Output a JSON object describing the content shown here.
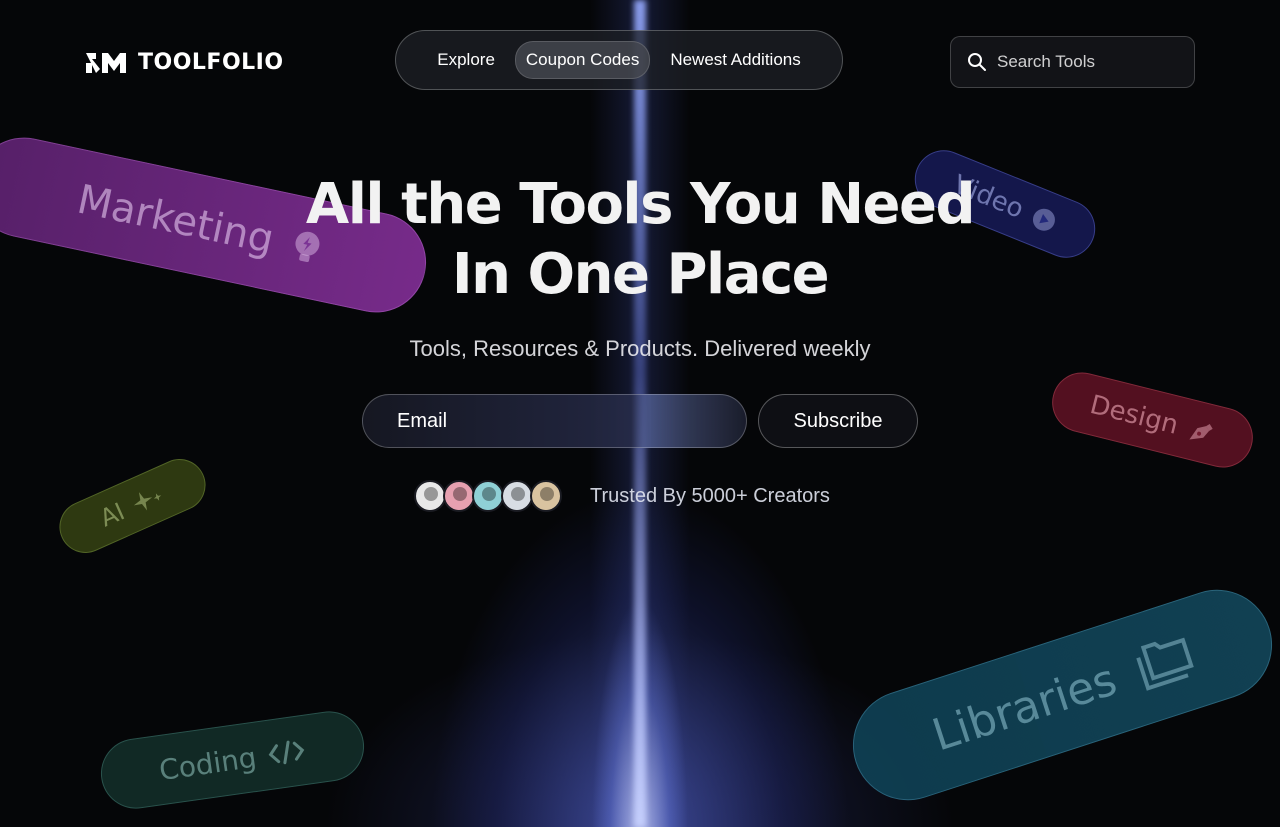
{
  "brand": {
    "name": "TOOLFOLIO"
  },
  "nav": {
    "items": [
      {
        "label": "Explore",
        "active": false
      },
      {
        "label": "Coupon Codes",
        "active": true
      },
      {
        "label": "Newest Additions",
        "active": false
      }
    ]
  },
  "search": {
    "placeholder": "Search Tools",
    "value": ""
  },
  "hero": {
    "title_line1": "All the Tools You Need",
    "title_line2": "In One Place",
    "subtitle": "Tools, Resources & Products. Delivered weekly"
  },
  "newsletter": {
    "email_placeholder": "Email",
    "email_value": "",
    "subscribe_label": "Subscribe"
  },
  "trust": {
    "text": "Trusted By 5000+ Creators",
    "avatar_colors": [
      "#e8e8e8",
      "#e6a0b0",
      "#8fd0d6",
      "#d8dde4",
      "#d9c3a0"
    ]
  },
  "categories": {
    "marketing": {
      "label": "Marketing",
      "icon": "lightbulb-icon",
      "color": "#7d2d91"
    },
    "video": {
      "label": "Video",
      "icon": "play-icon",
      "color": "#1e2378"
    },
    "design": {
      "label": "Design",
      "icon": "pen-icon",
      "color": "#6e1428"
    },
    "ai": {
      "label": "AI",
      "icon": "sparkle-icon",
      "color": "#3c4b14"
    },
    "coding": {
      "label": "Coding",
      "icon": "code-icon",
      "color": "#14322d"
    },
    "libraries": {
      "label": "Libraries",
      "icon": "folder-icon",
      "color": "#0f4155"
    }
  }
}
